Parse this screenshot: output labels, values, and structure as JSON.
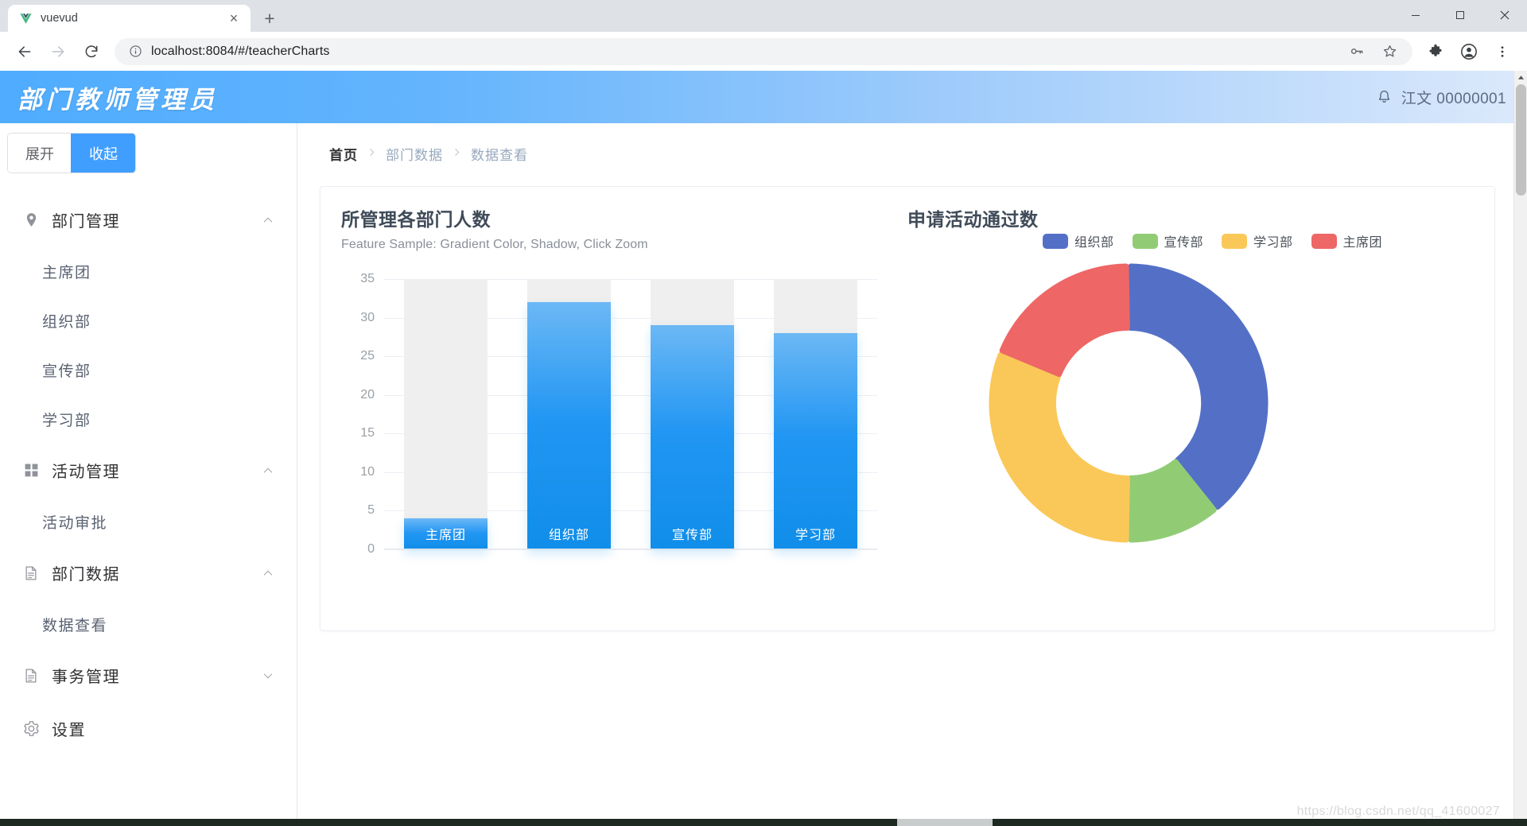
{
  "browser": {
    "tab": {
      "title": "vuevud",
      "favicon": "vue-logo-icon",
      "close_label": "×"
    },
    "new_tab_label": "+",
    "window_controls": {
      "minimize": "–",
      "maximize": "□",
      "close": "✕"
    },
    "nav": {
      "back": "←",
      "forward": "→",
      "reload": "⟳"
    },
    "omnibox": {
      "url_host": "localhost:8084",
      "url_path": "/#/teacherCharts",
      "full_url": "localhost:8084/#/teacherCharts",
      "info_icon": "site-info-icon"
    },
    "toolbar_icons": [
      "key-icon",
      "star-icon",
      "puzzle-icon",
      "profile-avatar-icon",
      "three-dot-menu-icon"
    ]
  },
  "app": {
    "header": {
      "logo_text": "部门教师管理员",
      "bell_icon": "bell-icon",
      "user_name": "江文 00000001"
    },
    "sidebar": {
      "toggle": {
        "expand_label": "展开",
        "collapse_label": "收起",
        "active": "收起"
      },
      "menu": [
        {
          "label": "部门管理",
          "icon": "location-pin-icon",
          "arrow": "chevron-up-icon",
          "type": "group"
        },
        {
          "label": "主席团",
          "type": "sub"
        },
        {
          "label": "组织部",
          "type": "sub"
        },
        {
          "label": "宣传部",
          "type": "sub"
        },
        {
          "label": "学习部",
          "type": "sub"
        },
        {
          "label": "活动管理",
          "icon": "grid-icon",
          "arrow": "chevron-up-icon",
          "type": "group"
        },
        {
          "label": "活动审批",
          "type": "sub"
        },
        {
          "label": "部门数据",
          "icon": "document-icon",
          "arrow": "chevron-up-icon",
          "type": "group"
        },
        {
          "label": "数据查看",
          "type": "sub"
        },
        {
          "label": "事务管理",
          "icon": "document-icon",
          "arrow": "chevron-down-icon",
          "type": "group"
        },
        {
          "label": "设置",
          "icon": "gear-icon",
          "arrow": "",
          "type": "group"
        }
      ]
    },
    "breadcrumb": {
      "home": "首页",
      "items": [
        "部门数据",
        "数据查看"
      ],
      "separator": "›"
    },
    "watermark": "https://blog.csdn.net/qq_41600027"
  },
  "chart_data": [
    {
      "type": "bar",
      "title": "所管理各部门人数",
      "subtitle": "Feature Sample: Gradient Color, Shadow, Click Zoom",
      "categories": [
        "主席团",
        "组织部",
        "宣传部",
        "学习部"
      ],
      "values": [
        4,
        32,
        29,
        28
      ],
      "xlabel": "",
      "ylabel": "",
      "ylim": [
        0,
        35
      ],
      "yticks": [
        0,
        5,
        10,
        15,
        20,
        25,
        30,
        35
      ],
      "grid": true,
      "legend": "none",
      "bar_gradient": [
        "#6cb8f5",
        "#108ee9"
      ],
      "track_color": "#efefef"
    },
    {
      "type": "pie",
      "variant": "donut",
      "title": "申请活动通过数",
      "legend_position": "top",
      "labels": [
        "组织部",
        "宣传部",
        "学习部",
        "主席团"
      ],
      "values": [
        39,
        11,
        31,
        19
      ],
      "percents": [
        "39%",
        "11%",
        "31%",
        "19%"
      ],
      "colors": [
        "#5470c6",
        "#91cc75",
        "#fac858",
        "#ee6666"
      ],
      "start_angle_deg": 90,
      "inner_radius_ratio": 0.55
    }
  ]
}
